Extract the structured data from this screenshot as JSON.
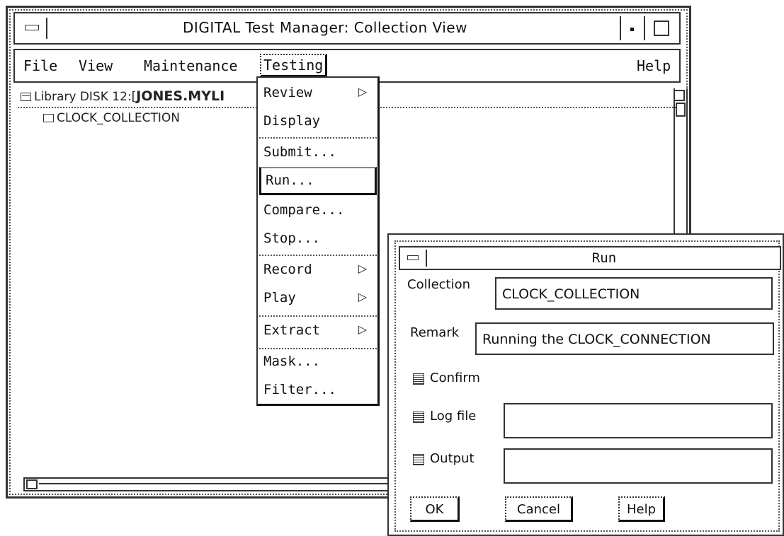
{
  "main_window": {
    "title": "DIGITAL Test Manager: Collection View",
    "menubar": [
      {
        "label": "File"
      },
      {
        "label": "View"
      },
      {
        "label": "Maintenance"
      },
      {
        "label": "Testing"
      },
      {
        "label": "Help"
      }
    ],
    "tree": {
      "library_label": "Library DISK 12:[",
      "library_path": "JONES.MYLI",
      "collection": "CLOCK_COLLECTION"
    }
  },
  "testing_menu": {
    "items": [
      {
        "label": "Review",
        "has_submenu": true
      },
      {
        "label": "Display"
      },
      {
        "label": "Submit..."
      },
      {
        "label": "Run...",
        "selected": true
      },
      {
        "label": "Compare..."
      },
      {
        "label": "Stop..."
      },
      {
        "label": "Record",
        "has_submenu": true
      },
      {
        "label": "Play",
        "has_submenu": true
      },
      {
        "label": "Extract",
        "has_submenu": true
      },
      {
        "label": "Mask..."
      },
      {
        "label": "Filter..."
      }
    ],
    "submenu_arrow": "▷"
  },
  "run_dialog": {
    "title": "Run",
    "collection_label": "Collection",
    "collection_value": "CLOCK_COLLECTION",
    "remark_label": "Remark",
    "remark_value": "Running the CLOCK_CONNECTION",
    "confirm_label": "Confirm",
    "logfile_label": "Log file",
    "logfile_value": "",
    "output_label": "Output",
    "output_value": "",
    "ok_label": "OK",
    "cancel_label": "Cancel",
    "help_label": "Help"
  }
}
